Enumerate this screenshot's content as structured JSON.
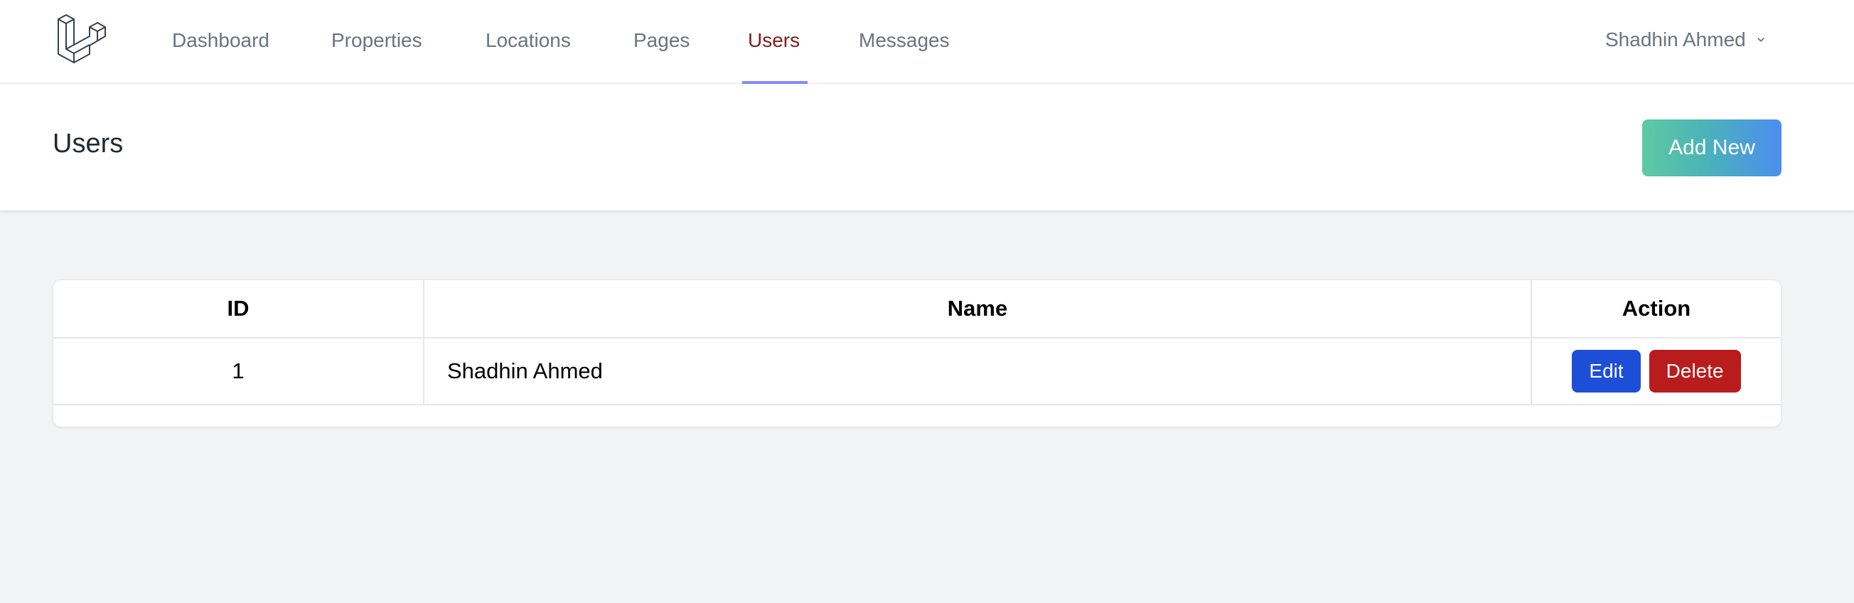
{
  "nav": {
    "logo_icon": "laravel-logo-icon",
    "links": [
      {
        "label": "Dashboard",
        "active": false
      },
      {
        "label": "Properties",
        "active": false
      },
      {
        "label": "Locations",
        "active": false
      },
      {
        "label": "Pages",
        "active": false
      },
      {
        "label": "Users",
        "active": true
      },
      {
        "label": "Messages",
        "active": false
      }
    ],
    "user_name": "Shadhin Ahmed",
    "user_menu_icon": "chevron-down-icon"
  },
  "header": {
    "title": "Users",
    "add_button_label": "Add New"
  },
  "table": {
    "columns": [
      "ID",
      "Name",
      "Action"
    ],
    "rows": [
      {
        "id": "1",
        "name": "Shadhin Ahmed",
        "edit_label": "Edit",
        "delete_label": "Delete"
      }
    ]
  },
  "colors": {
    "active_nav_text": "#7f1d1d",
    "active_nav_underline": "#818cf8",
    "edit_button": "#1d4ed8",
    "delete_button": "#b91c1c",
    "add_button_gradient_start": "#5fc9a1",
    "add_button_gradient_end": "#4b8ef0",
    "page_background": "#f3f4f6"
  }
}
